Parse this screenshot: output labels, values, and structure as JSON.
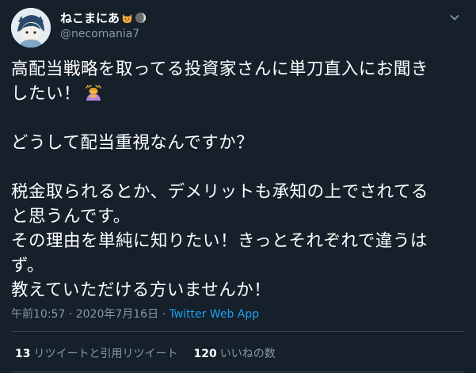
{
  "user": {
    "display_name": "ねこまにあ",
    "name_emojis": [
      "cat-face-emoji",
      "moon-emoji"
    ],
    "handle": "@necomania7",
    "avatar": "avatar-illustration"
  },
  "tweet": {
    "lines": [
      "高配当戦略を取ってる投資家さんに単刀直入にお聞き",
      "したい！",
      "",
      "どうして配当重視なんですか？",
      "",
      "税金取られるとか、デメリットも承知の上でされてる",
      "と思うんです。",
      "その理由を単純に知りたい！きっとそれぞれで違うは",
      "ず。",
      "教えていただける方いませんか！"
    ],
    "inline_emoji": "person-bowing-emoji"
  },
  "meta": {
    "time": "午前10:57",
    "separator": "·",
    "date": "2020年7月16日",
    "source": "Twitter Web App"
  },
  "stats": {
    "retweets_count": "13",
    "retweets_label": "リツイートと引用リツイート",
    "likes_count": "120",
    "likes_label": "いいねの数"
  },
  "colors": {
    "background": "#15202b",
    "text_primary": "#ffffff",
    "text_secondary": "#8899a6",
    "link": "#1da1f2",
    "divider": "#38444d"
  }
}
